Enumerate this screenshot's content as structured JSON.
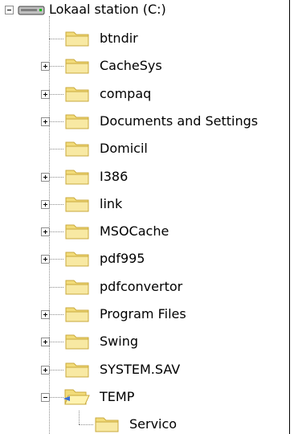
{
  "root": {
    "label": "Lokaal station (C:)",
    "expanded": true,
    "icon": "drive-icon"
  },
  "items": [
    {
      "label": "btndir",
      "has_children": false
    },
    {
      "label": "CacheSys",
      "has_children": true
    },
    {
      "label": "compaq",
      "has_children": true
    },
    {
      "label": "Documents and Settings",
      "has_children": true
    },
    {
      "label": "Domicil",
      "has_children": false
    },
    {
      "label": "I386",
      "has_children": true
    },
    {
      "label": "link",
      "has_children": true
    },
    {
      "label": "MSOCache",
      "has_children": true
    },
    {
      "label": "pdf995",
      "has_children": true
    },
    {
      "label": "pdfconvertor",
      "has_children": false
    },
    {
      "label": "Program Files",
      "has_children": true
    },
    {
      "label": "Swing",
      "has_children": true
    },
    {
      "label": "SYSTEM.SAV",
      "has_children": true
    },
    {
      "label": "TEMP",
      "has_children": true,
      "expanded": true,
      "open": true,
      "children": [
        {
          "label": "Servico",
          "has_children": false
        }
      ]
    }
  ],
  "colors": {
    "folder": "#f2dc7a",
    "folder_dark": "#c9a93c",
    "line": "#8c8c8c"
  }
}
